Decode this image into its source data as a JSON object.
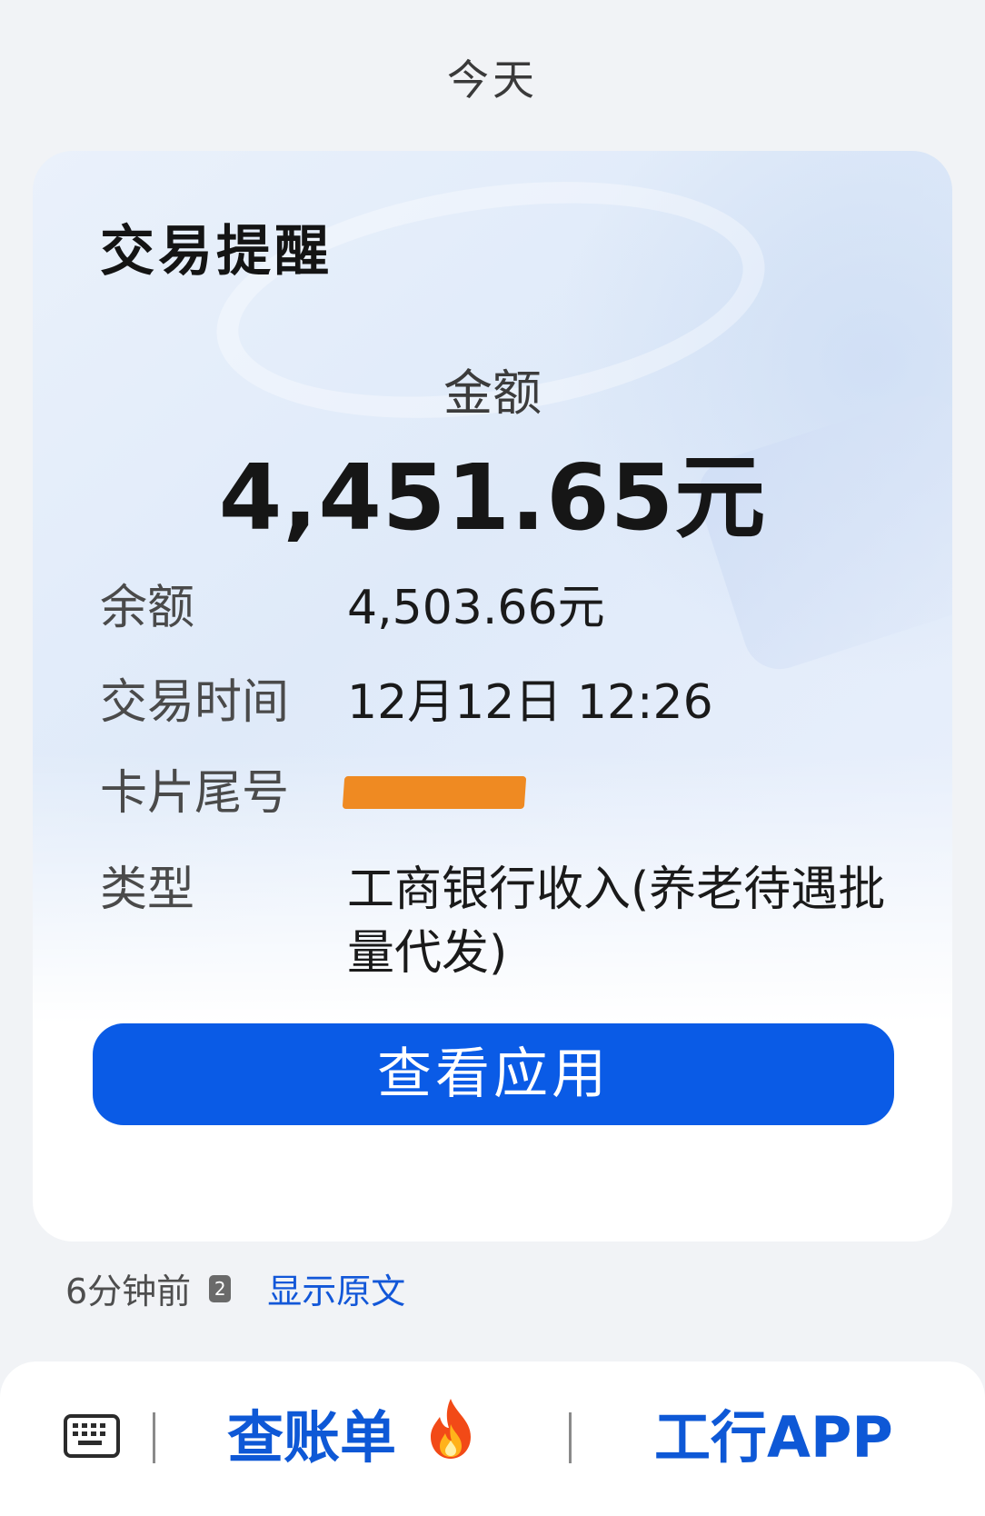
{
  "header": {
    "day_label": "今天"
  },
  "card": {
    "title": "交易提醒",
    "amount_label": "金额",
    "amount_value": "4,451.65元",
    "rows": {
      "balance": {
        "label": "余额",
        "value": "4,503.66元"
      },
      "time": {
        "label": "交易时间",
        "value": "12月12日 12:26"
      },
      "card_tail": {
        "label": "卡片尾号",
        "value": ""
      },
      "type": {
        "label": "类型",
        "value": "工商银行收入(养老待遇批量代发)"
      }
    },
    "view_button_label": "查看应用"
  },
  "meta": {
    "time_ago": "6分钟前",
    "sim_badge": "2",
    "show_original_label": "显示原文"
  },
  "bottom_bar": {
    "bill_label": "查账单",
    "app_label": "工行APP",
    "icons": [
      "keyboard-icon",
      "fire-icon"
    ]
  },
  "colors": {
    "accent": "#0a5be6",
    "link": "#1257d8",
    "redaction": "#ef8a22"
  }
}
